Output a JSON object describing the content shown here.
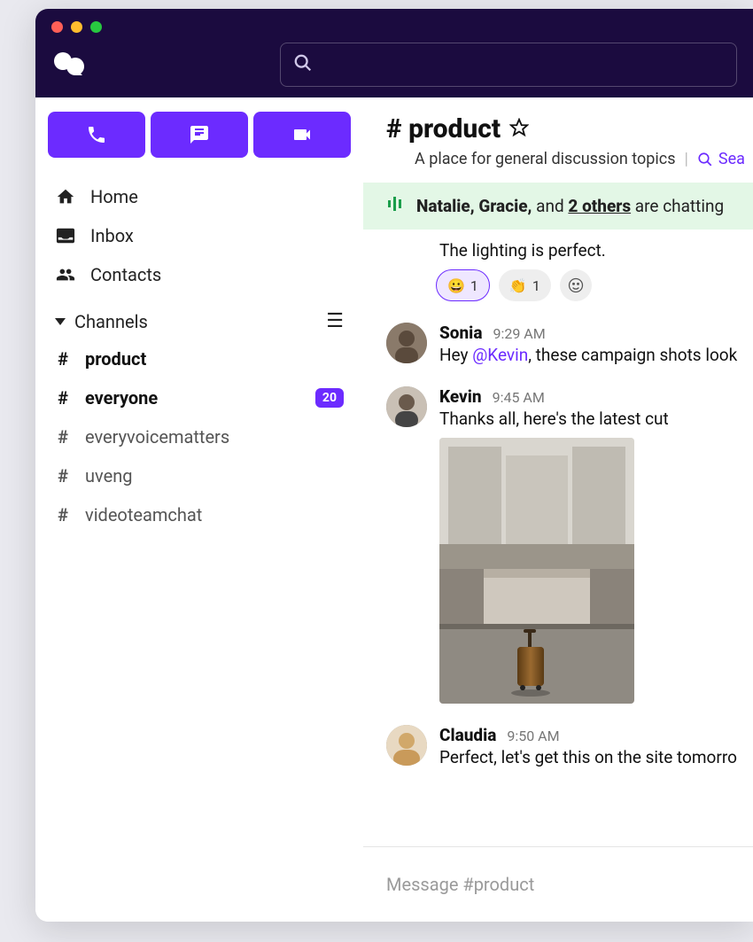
{
  "header": {
    "search_placeholder": ""
  },
  "sidebar": {
    "nav": [
      {
        "icon": "home",
        "label": "Home"
      },
      {
        "icon": "inbox",
        "label": "Inbox"
      },
      {
        "icon": "contacts",
        "label": "Contacts"
      }
    ],
    "channels_label": "Channels",
    "channels": [
      {
        "name": "product",
        "bold": true
      },
      {
        "name": "everyone",
        "bold": true,
        "badge": "20"
      },
      {
        "name": "everyvoicematters",
        "bold": false
      },
      {
        "name": "uveng",
        "bold": false
      },
      {
        "name": "videoteamchat",
        "bold": false
      }
    ]
  },
  "channel": {
    "hash": "#",
    "name": "product",
    "title_display": "# product",
    "description": "A place for general discussion topics",
    "search_label": "Sea"
  },
  "banner": {
    "names_prefix": "Natalie, Gracie,",
    "and": " and ",
    "others": "2 others",
    "suffix": " are chatting"
  },
  "prev_message": {
    "text": "The lighting is perfect."
  },
  "reactions": [
    {
      "emoji": "😀",
      "count": "1",
      "selected": true
    },
    {
      "emoji": "👏",
      "count": "1",
      "selected": false
    }
  ],
  "messages": [
    {
      "author": "Sonia",
      "time": "9:29 AM",
      "text_before": "Hey ",
      "mention": "@Kevin",
      "text_after": ", these campaign shots look"
    },
    {
      "author": "Kevin",
      "time": "9:45 AM",
      "text": "Thanks all, here's the latest cut",
      "attachment": true
    },
    {
      "author": "Claudia",
      "time": "9:50 AM",
      "text": "Perfect, let's get this on the site tomorro"
    }
  ],
  "composer": {
    "placeholder": "Message #product"
  }
}
